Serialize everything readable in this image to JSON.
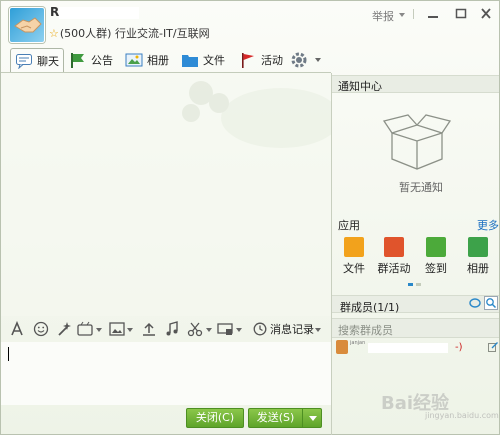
{
  "header": {
    "group_name": "R",
    "group_meta_count": "(500人群)",
    "group_meta_category": "行业交流-IT/互联网",
    "report_label": "举报"
  },
  "tabs": [
    {
      "label": "聊天",
      "icon": "chat-bubble-icon"
    },
    {
      "label": "公告",
      "icon": "flag-icon"
    },
    {
      "label": "相册",
      "icon": "picture-icon"
    },
    {
      "label": "文件",
      "icon": "folder-icon"
    },
    {
      "label": "活动",
      "icon": "red-flag-icon"
    }
  ],
  "right_panel": {
    "notice_title": "通知中心",
    "no_notice": "暂无通知",
    "apps_title": "应用",
    "more_label": "更多",
    "apps": [
      {
        "label": "文件",
        "icon": "folder-app-icon"
      },
      {
        "label": "群活动",
        "icon": "group-activity-icon"
      },
      {
        "label": "签到",
        "icon": "checkin-icon"
      },
      {
        "label": "相册",
        "icon": "album-app-icon"
      }
    ],
    "members_title": "群成员(1/1)",
    "member_search_placeholder": "搜索群成员",
    "member": {
      "name": "janjan",
      "suffix": "-)"
    }
  },
  "input_toolbar": {
    "history_label": "消息记录"
  },
  "buttons": {
    "close_label": "关闭(C)",
    "send_label": "发送(S)"
  },
  "watermark": {
    "text": "Bai经验",
    "sub": "jingyan.baidu.com"
  },
  "colors": {
    "accent_green": "#5ea42a",
    "link_blue": "#1a6fc0",
    "member_red": "#cc1d1d"
  }
}
